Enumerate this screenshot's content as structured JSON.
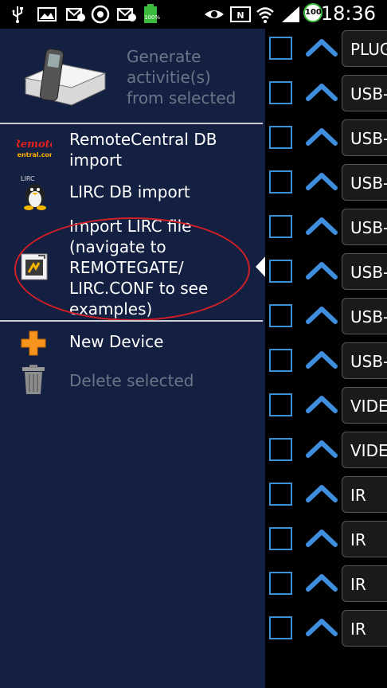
{
  "status_bar": {
    "time": "18:36",
    "battery_level": "100",
    "battery_small_text": "100%"
  },
  "drawer": {
    "generate_label": "Generate activitie(s) from selected",
    "generate_lines": [
      "Generate",
      "activitie(s)",
      "from selected"
    ],
    "items": [
      {
        "label_lines": [
          "RemoteCentral DB",
          "import"
        ],
        "icon": "remotecentral-icon",
        "icon_text": "Remote Central"
      },
      {
        "label_lines": [
          "LIRC DB import"
        ],
        "icon": "lirc-tux-icon",
        "icon_text": "LIRC"
      },
      {
        "label_lines": [
          "Import LIRC file",
          "(navigate to",
          "REMOTEGATE/",
          "LIRC.CONF to see",
          "examples)"
        ],
        "icon": "file-import-icon"
      },
      {
        "label_lines": [
          "New Device"
        ],
        "icon": "plus-icon"
      },
      {
        "label_lines": [
          "Delete selected"
        ],
        "icon": "trash-icon",
        "disabled": true
      }
    ]
  },
  "device_list": [
    {
      "label": "PLUG"
    },
    {
      "label": "USB-"
    },
    {
      "label": "USB-"
    },
    {
      "label": "USB-"
    },
    {
      "label": "USB-"
    },
    {
      "label": "USB-"
    },
    {
      "label": "USB-"
    },
    {
      "label": "USB-"
    },
    {
      "label": "VIDE"
    },
    {
      "label": "VIDE"
    },
    {
      "label": "IR"
    },
    {
      "label": "IR"
    },
    {
      "label": "IR"
    },
    {
      "label": "IR"
    }
  ],
  "colors": {
    "drawer_bg": "#132041",
    "annotation_red": "#d01f26",
    "checkbox_blue": "#3b8fd3"
  }
}
